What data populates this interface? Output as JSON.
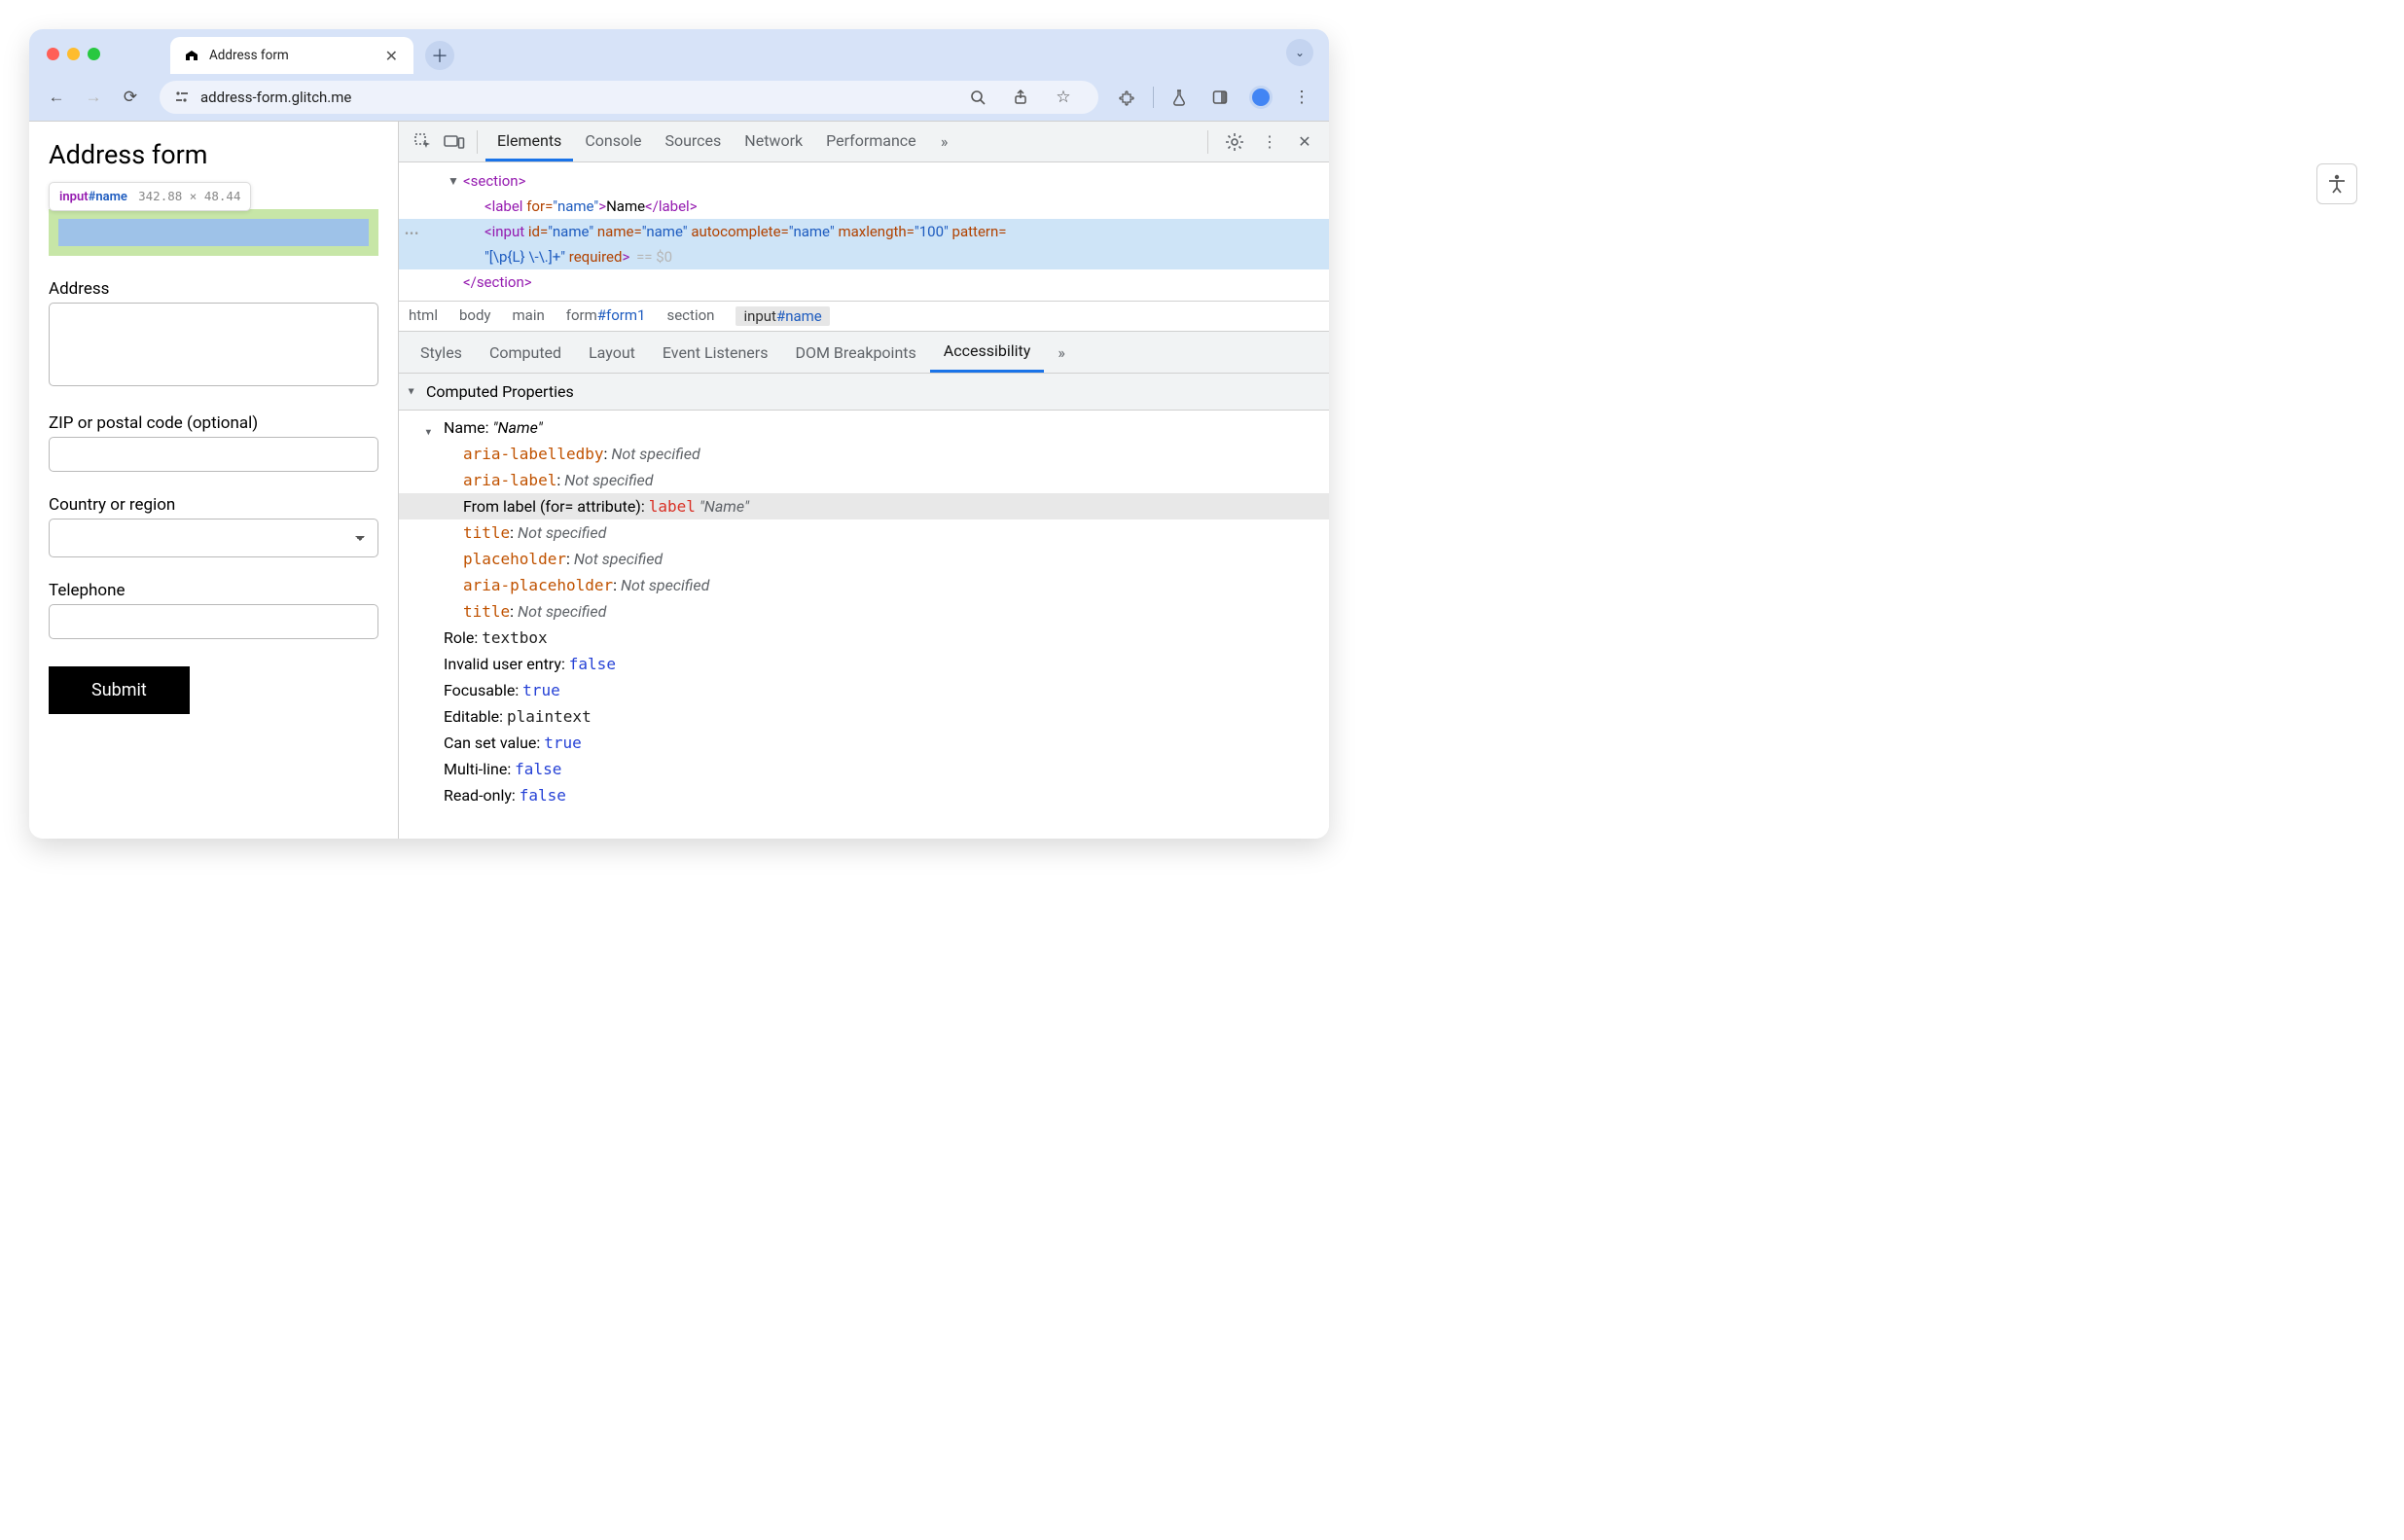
{
  "browser": {
    "tab_title": "Address form",
    "url": "address-form.glitch.me"
  },
  "hover_tooltip": {
    "tag": "input",
    "id": "#name",
    "dimensions": "342.88 × 48.44"
  },
  "page": {
    "heading": "Address form",
    "labels": {
      "address": "Address",
      "zip": "ZIP or postal code (optional)",
      "country": "Country or region",
      "telephone": "Telephone"
    },
    "submit": "Submit"
  },
  "devtools": {
    "tabs": [
      "Elements",
      "Console",
      "Sources",
      "Network",
      "Performance"
    ],
    "active_tab": "Elements",
    "dom": {
      "section_open": "<section>",
      "section_close": "</section>",
      "label_tag": "label",
      "label_for_attr": "for",
      "label_for_val": "\"name\"",
      "label_text": "Name",
      "input_tag": "input",
      "attrs": {
        "id_k": "id",
        "id_v": "\"name\"",
        "name_k": "name",
        "name_v": "\"name\"",
        "auto_k": "autocomplete",
        "auto_v": "\"name\"",
        "max_k": "maxlength",
        "max_v": "\"100\"",
        "pat_k": "pattern",
        "pat_v": "\"[\\p{L} \\-\\.]+\"",
        "req_k": "required"
      },
      "eq": "== $0"
    },
    "crumbs": [
      "html",
      "body",
      "main",
      "form#form1",
      "section",
      "input#name"
    ],
    "subtabs": [
      "Styles",
      "Computed",
      "Layout",
      "Event Listeners",
      "DOM Breakpoints",
      "Accessibility"
    ],
    "active_subtab": "Accessibility",
    "acc_section": "Computed Properties",
    "acc": {
      "name_row": {
        "label": "Name: ",
        "value": "\"Name\""
      },
      "sources": [
        {
          "prop": "aria-labelledby",
          "val": "Not specified"
        },
        {
          "prop": "aria-label",
          "val": "Not specified"
        },
        {
          "from_label_prefix": "From label (for= attribute): ",
          "from_label_tag": "label",
          "from_label_val": " \"Name\""
        },
        {
          "prop": "title",
          "val": "Not specified"
        },
        {
          "prop": "placeholder",
          "val": "Not specified"
        },
        {
          "prop": "aria-placeholder",
          "val": "Not specified"
        },
        {
          "prop": "title",
          "val": "Not specified"
        }
      ],
      "rows": [
        {
          "k": "Role: ",
          "v": "textbox",
          "cls": "mono c-plain"
        },
        {
          "k": "Invalid user entry: ",
          "v": "false",
          "cls": "mono c-blue"
        },
        {
          "k": "Focusable: ",
          "v": "true",
          "cls": "mono c-blue"
        },
        {
          "k": "Editable: ",
          "v": "plaintext",
          "cls": "mono c-plain"
        },
        {
          "k": "Can set value: ",
          "v": "true",
          "cls": "mono c-blue"
        },
        {
          "k": "Multi-line: ",
          "v": "false",
          "cls": "mono c-blue"
        },
        {
          "k": "Read-only: ",
          "v": "false",
          "cls": "mono c-blue"
        }
      ]
    }
  }
}
